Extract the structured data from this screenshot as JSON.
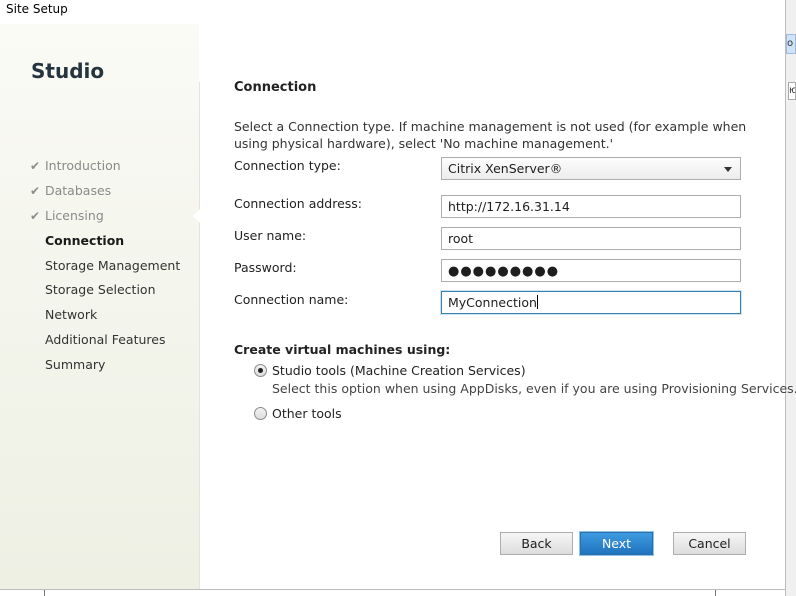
{
  "window": {
    "title": "Site Setup"
  },
  "edge": {
    "tab1_text": "o",
    "tab2_text": "ю"
  },
  "sidebar": {
    "title": "Studio",
    "items": [
      {
        "label": "Introduction",
        "state": "done"
      },
      {
        "label": "Databases",
        "state": "done"
      },
      {
        "label": "Licensing",
        "state": "done"
      },
      {
        "label": "Connection",
        "state": "current"
      },
      {
        "label": "Storage Management",
        "state": "pending"
      },
      {
        "label": "Storage Selection",
        "state": "pending"
      },
      {
        "label": "Network",
        "state": "pending"
      },
      {
        "label": "Additional Features",
        "state": "pending"
      },
      {
        "label": "Summary",
        "state": "pending"
      }
    ],
    "check_glyph": "✔"
  },
  "main": {
    "heading": "Connection",
    "description": "Select a Connection type. If machine management is not used (for example when using physical hardware), select 'No machine management.'",
    "fields": {
      "connection_type": {
        "label": "Connection type:",
        "value": "Citrix XenServer®"
      },
      "connection_address": {
        "label": "Connection address:",
        "value": "http://172.16.31.14"
      },
      "user_name": {
        "label": "User name:",
        "value": "root"
      },
      "password": {
        "label": "Password:",
        "value": "●●●●●●●●●"
      },
      "connection_name": {
        "label": "Connection name:",
        "value": "MyConnection"
      }
    },
    "create_vm": {
      "heading": "Create virtual machines using:",
      "options": [
        {
          "label": "Studio tools (Machine Creation Services)",
          "hint": "Select this option when using AppDisks, even if you are using Provisioning Services.",
          "checked": true
        },
        {
          "label": "Other tools",
          "hint": "",
          "checked": false
        }
      ]
    }
  },
  "buttons": {
    "back": "Back",
    "next": "Next",
    "cancel": "Cancel"
  },
  "colors": {
    "accent": "#1f74bd",
    "focus_border": "#3c7fb1"
  }
}
